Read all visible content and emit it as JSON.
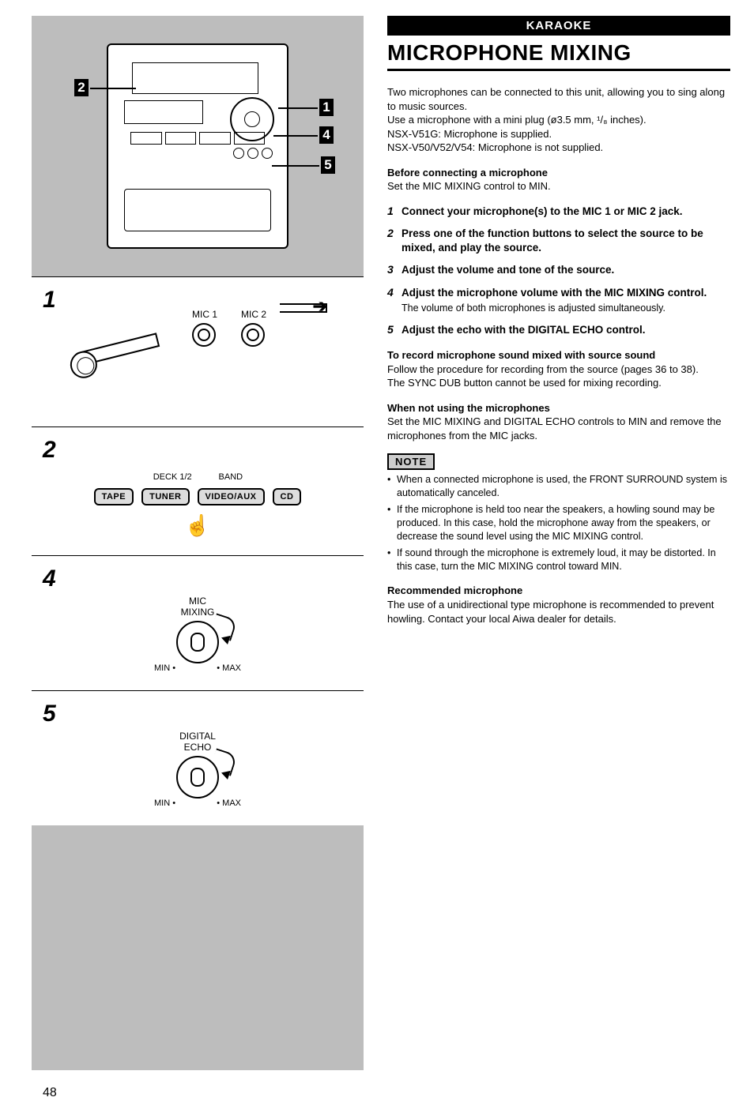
{
  "category": "KARAOKE",
  "title": "MICROPHONE MIXING",
  "intro": {
    "p1": "Two microphones can be connected to this unit, allowing you to sing along to music sources.",
    "p2": "Use a microphone with a mini plug (ø3.5 mm, ¹/₈ inches).",
    "p3": "NSX-V51G: Microphone is supplied.",
    "p4": "NSX-V50/V52/V54: Microphone is not supplied."
  },
  "before": {
    "head": "Before connecting a microphone",
    "body": "Set the MIC MIXING control to MIN."
  },
  "steps": {
    "s1": "Connect your microphone(s) to the MIC 1 or MIC 2 jack.",
    "s2": "Press one of the function buttons to select the source to be mixed, and play the source.",
    "s3": "Adjust the volume and tone of the source.",
    "s4": "Adjust the microphone volume with the MIC MIXING control.",
    "s4sub": "The volume of both microphones is adjusted simultaneously.",
    "s5": "Adjust the echo with the DIGITAL ECHO control."
  },
  "record": {
    "head": "To record microphone sound mixed with source sound",
    "b1": "Follow the procedure for recording from the source (pages 36 to 38).",
    "b2": "The SYNC DUB button cannot be used for mixing recording."
  },
  "notusing": {
    "head": "When not using the microphones",
    "body": "Set the MIC MIXING and DIGITAL ECHO controls to MIN and remove the microphones from the MIC jacks."
  },
  "note_label": "NOTE",
  "notes": {
    "n1": "When a connected microphone is used, the FRONT SURROUND system is automatically canceled.",
    "n2": "If the microphone is held too near the speakers, a howling sound may be produced. In this case, hold the microphone away from the speakers, or decrease the sound level using the MIC MIXING control.",
    "n3": "If sound through the microphone is extremely loud, it may be distorted. In this case, turn the MIC MIXING control toward MIN."
  },
  "recommended": {
    "head": "Recommended microphone",
    "body": "The use of a unidirectional type microphone is recommended to prevent howling. Contact your local Aiwa dealer for details."
  },
  "diagram": {
    "mic1": "MIC 1",
    "mic2": "MIC 2",
    "deck": "DECK 1/2",
    "band": "BAND",
    "tape": "TAPE",
    "tuner": "TUNER",
    "video": "VIDEO/AUX",
    "cd": "CD",
    "mic_mixing": "MIC",
    "mic_mixing2": "MIXING",
    "digital": "DIGITAL",
    "echo": "ECHO",
    "min": "MIN",
    "max": "MAX",
    "n1": "1",
    "n2": "2",
    "n4": "4",
    "n5": "5",
    "p1": "1",
    "p2": "2",
    "p4": "4",
    "p5": "5"
  },
  "page_number": "48"
}
